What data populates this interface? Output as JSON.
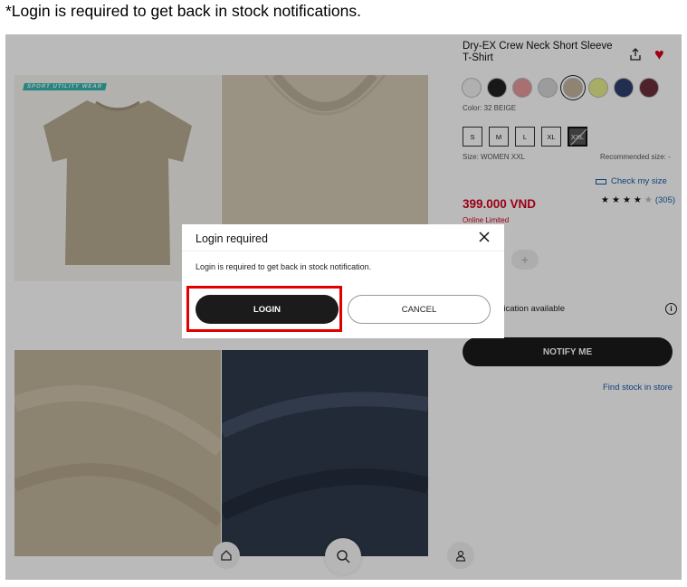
{
  "caption": "*Login is required to get back in stock notifications.",
  "product": {
    "title": "Dry-EX Crew Neck Short Sleeve T-Shirt",
    "badge": "SPORT UTILITY WEAR",
    "color_label": "Color: 32 BEIGE",
    "swatches": [
      "#f2f2f2",
      "#222222",
      "#e79a9c",
      "#d6d6d6",
      "#c3b59b",
      "#e5ee8a",
      "#2f3f6e",
      "#6a2f3b"
    ],
    "selected_swatch_index": 4,
    "sizes": [
      "S",
      "M",
      "L",
      "XL",
      "XXL"
    ],
    "selected_size": "XXL",
    "size_label": "Size: WOMEN XXL",
    "recommended_size": "Recommended size: -",
    "check_size": "Check my size",
    "price": "399.000 VND",
    "online_limited": "Online Limited",
    "rating_stars": 4,
    "rating_max": 5,
    "review_count": "(305)",
    "qty_plus": "+",
    "notification_text": "tification available",
    "notify_button": "NOTIFY ME",
    "find_stock": "Find stock in store"
  },
  "icons": {
    "share": "share-icon",
    "favorite": "heart-icon",
    "info": "info-icon",
    "home": "home-icon",
    "search": "search-icon",
    "account": "user-icon",
    "close": "close-icon"
  },
  "modal": {
    "title": "Login required",
    "message": "Login is required to get back in stock notification.",
    "login_button": "LOGIN",
    "cancel_button": "CANCEL"
  }
}
